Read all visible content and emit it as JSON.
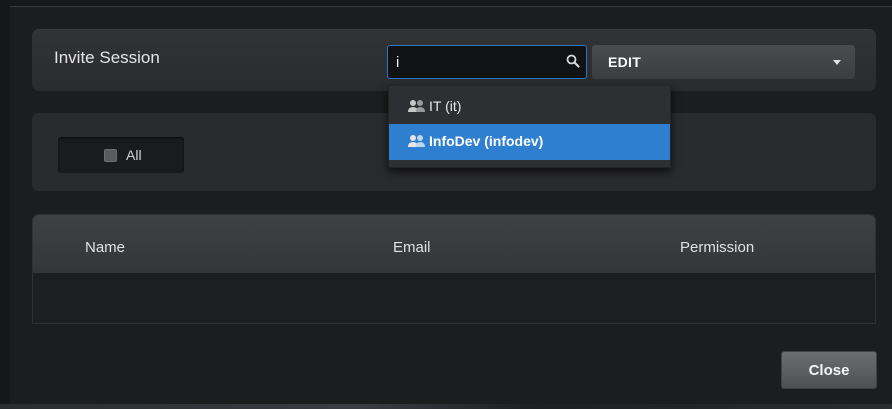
{
  "dialog": {
    "title": "Invite Session"
  },
  "search": {
    "value": "i",
    "icon": "search-icon"
  },
  "permission_select": {
    "selected": "EDIT",
    "icon": "chevron-down-icon"
  },
  "dropdown": {
    "items": [
      {
        "label": "IT (it)",
        "icon": "group-icon",
        "selected": false
      },
      {
        "label": "InfoDev (infodev)",
        "icon": "group-icon",
        "selected": true
      }
    ]
  },
  "filter": {
    "all_label": "All",
    "checked": false
  },
  "table": {
    "columns": [
      "Name",
      "Email",
      "Permission"
    ],
    "rows": []
  },
  "footer": {
    "close_label": "Close"
  },
  "colors": {
    "accent": "#2f7fd1",
    "background": "#1c1d1f",
    "panel": "#2a2b2d"
  }
}
